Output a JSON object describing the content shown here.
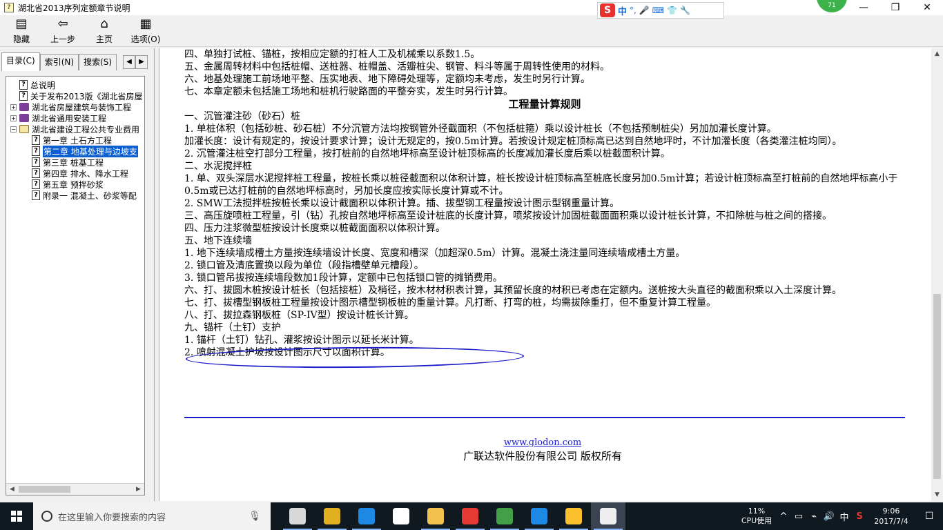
{
  "window": {
    "title": "湖北省2013序列定额章节说明",
    "controls": [
      "—",
      "❐",
      "✕"
    ]
  },
  "ime_bar": {
    "logo": "S",
    "mode": "中",
    "icons": [
      "°,",
      "🎤",
      "⌨",
      "👕",
      "🔧"
    ]
  },
  "badge": {
    "value": "71"
  },
  "toolbar": [
    {
      "icon": "hide-icon",
      "glyph": "▤",
      "label": "隐藏"
    },
    {
      "icon": "back-arrow-icon",
      "glyph": "⇦",
      "label": "上一步"
    },
    {
      "icon": "home-icon",
      "glyph": "⌂",
      "label": "主页"
    },
    {
      "icon": "options-icon",
      "glyph": "▦",
      "label": "选项(O)"
    }
  ],
  "left_tabs": {
    "items": [
      "目录(C)",
      "索引(N)",
      "搜索(S)"
    ],
    "active": 0,
    "arrows": [
      "◀",
      "▶"
    ]
  },
  "tree": [
    {
      "level": 0,
      "type": "help",
      "expander": "",
      "label": "总说明"
    },
    {
      "level": 0,
      "type": "help",
      "expander": "",
      "label": "关于发布2013版《湖北省房屋"
    },
    {
      "level": 0,
      "type": "book",
      "expander": "+",
      "label": "湖北省房屋建筑与装饰工程"
    },
    {
      "level": 0,
      "type": "book",
      "expander": "+",
      "label": "湖北省通用安装工程"
    },
    {
      "level": 0,
      "type": "book-open",
      "expander": "−",
      "label": "湖北省建设工程公共专业费用"
    },
    {
      "level": 1,
      "type": "help",
      "expander": "",
      "label": "第一章 土石方工程"
    },
    {
      "level": 1,
      "type": "help",
      "expander": "",
      "label": "第二章 地基处理与边坡支",
      "selected": true
    },
    {
      "level": 1,
      "type": "help",
      "expander": "",
      "label": "第三章 桩基工程"
    },
    {
      "level": 1,
      "type": "help",
      "expander": "",
      "label": "第四章 排水、降水工程"
    },
    {
      "level": 1,
      "type": "help",
      "expander": "",
      "label": "第五章 预拌砂浆"
    },
    {
      "level": 1,
      "type": "help",
      "expander": "",
      "label": "附录一 混凝土、砂浆等配"
    }
  ],
  "document": {
    "lines": [
      {
        "text": "四、单独打试桩、锚桩，按相应定额的打桩人工及机械乘以系数1.5。"
      },
      {
        "text": "五、金属周转材料中包括桩帽、送桩器、桩帽盖、活瓣桩尖、钢管、料斗等属于周转性使用的材料。"
      },
      {
        "text": "六、地基处理施工前场地平整、压实地表、地下障碍处理等，定额均未考虑，发生时另行计算。"
      },
      {
        "text": "七、本章定额未包括施工场地和桩机行驶路面的平整夯实，发生时另行计算。"
      },
      {
        "text": "工程量计算规则",
        "heading": true
      },
      {
        "text": "一、沉管灌注砂（砂石）桩"
      },
      {
        "text": "1. 单桩体积（包括砂桩、砂石桩）不分沉管方法均按钢管外径截面积（不包括桩箍）乘以设计桩长（不包括预制桩尖）另加加灌长度计算。"
      },
      {
        "text": "加灌长度：设计有规定的，按设计要求计算；设计无规定的，按0.5m计算。若按设计规定桩顶标高已达到自然地坪时，不计加灌长度（各类灌注桩均同）。"
      },
      {
        "text": "2. 沉管灌注桩空打部分工程量，按打桩前的自然地坪标高至设计桩顶标高的长度减加灌长度后乘以桩截面积计算。"
      },
      {
        "text": "二、水泥搅拌桩"
      },
      {
        "text": "1. 单、双头深层水泥搅拌桩工程量，按桩长乘以桩径截面积以体积计算，桩长按设计桩顶标高至桩底长度另加0.5m计算；若设计桩顶标高至打桩前的自然地坪标高小于0.5m或已达打桩前的自然地坪标高时，另加长度应按实际长度计算或不计。"
      },
      {
        "text": "2. SMW工法搅拌桩按桩长乘以设计截面积以体积计算。插、拔型钢工程量按设计图示型钢重量计算。"
      },
      {
        "text": "三、高压旋喷桩工程量，引（钻）孔按自然地坪标高至设计桩底的长度计算，喷浆按设计加固桩截面面积乘以设计桩长计算，不扣除桩与桩之间的搭接。"
      },
      {
        "text": "四、压力注浆微型桩按设计长度乘以桩截面面积以体积计算。"
      },
      {
        "text": "五、地下连续墙"
      },
      {
        "text": "1. 地下连续墙成槽土方量按连续墙设计长度、宽度和槽深（加超深0.5m）计算。混凝土浇注量同连续墙成槽土方量。"
      },
      {
        "text": "2. 锁口管及清底置换以段为单位（段指槽壁单元槽段）。"
      },
      {
        "text": "3. 锁口管吊拔按连续墙段数加1段计算，定额中已包括锁口管的摊销费用。"
      },
      {
        "text": "六、打、拔圆木桩按设计桩长（包括接桩）及梢径，按木材材积表计算，其预留长度的材积已考虑在定额内。送桩按大头直径的截面积乘以入土深度计算。"
      },
      {
        "text": "七、打、拔槽型钢板桩工程量按设计图示槽型钢板桩的重量计算。凡打断、打弯的桩，均需拔除重打，但不重复计算工程量。"
      },
      {
        "text": "八、打、拔拉森钢板桩（SP-IV型）按设计桩长计算。"
      },
      {
        "text": "九、锚杆（土钉）支护"
      },
      {
        "text": "1. 锚杆（土钉）钻孔、灌浆按设计图示以延长米计算。"
      },
      {
        "text": "2. 喷射混凝土护坡按设计图示尺寸以面积计算。"
      }
    ],
    "footer_link": "www.glodon.com",
    "footer_copyright": "广联达软件股份有限公司 版权所有"
  },
  "taskbar": {
    "search_placeholder": "在这里输入你要搜索的内容",
    "apps": [
      {
        "icon": "network-app-icon",
        "color": "#d8d8d8"
      },
      {
        "icon": "browser-360-icon",
        "color": "#e0b020"
      },
      {
        "icon": "edge-icon",
        "color": "#1e88e5"
      },
      {
        "icon": "store-icon",
        "color": "#ffffff"
      },
      {
        "icon": "file-explorer-icon",
        "color": "#f2c14e"
      },
      {
        "icon": "app-red-swirl-icon",
        "color": "#e53935"
      },
      {
        "icon": "app-green-circle-icon",
        "color": "#43a047"
      },
      {
        "icon": "app-blue-plus-icon",
        "color": "#1e88e5"
      },
      {
        "icon": "notes-app-icon",
        "color": "#fbc02d"
      },
      {
        "icon": "help-app-icon",
        "color": "#eeeeee"
      }
    ],
    "cpu_percent": "11%",
    "cpu_label": "CPU使用",
    "tray_symbols": [
      "^",
      "▭",
      "⌁",
      "🔊",
      "中",
      "S"
    ],
    "time": "9:06",
    "date": "2017/7/4",
    "notification": "☐"
  }
}
